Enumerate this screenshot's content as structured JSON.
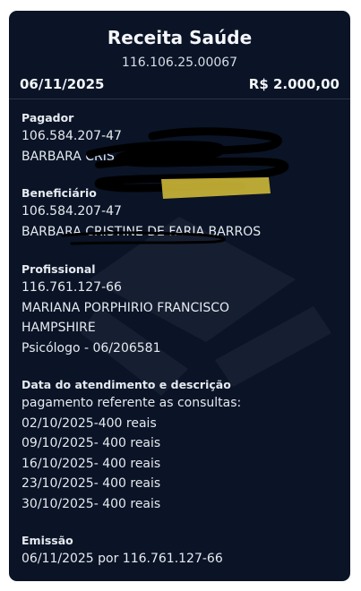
{
  "header": {
    "title": "Receita Saúde",
    "receipt_number": "116.106.25.00067",
    "date": "06/11/2025",
    "amount": "R$ 2.000,00"
  },
  "pagador": {
    "label": "Pagador",
    "cpf": "106.584.207-47",
    "name": "BARBARA CRIS"
  },
  "beneficiario": {
    "label": "Beneficiário",
    "cpf": "106.584.207-47",
    "name": "BARBARA CRISTINE DE FARIA BARROS"
  },
  "profissional": {
    "label": "Profissional",
    "cpf": "116.761.127-66",
    "name_line1": "MARIANA PORPHIRIO FRANCISCO",
    "name_line2": "HAMPSHIRE",
    "registration": "Psicólogo - 06/206581"
  },
  "atendimento": {
    "label": "Data do atendimento e descrição",
    "lines": [
      "pagamento referente as consultas:",
      "02/10/2025-400 reais",
      "09/10/2025- 400 reais",
      "16/10/2025- 400 reais",
      "23/10/2025- 400  reais",
      "30/10/2025- 400 reais"
    ]
  },
  "emissao": {
    "label": "Emissão",
    "value": "06/11/2025  por 116.761.127-66"
  },
  "colors": {
    "card_background": "#0a1426",
    "text": "#e8ecf2",
    "redaction": "#000000",
    "highlight": "#d9c23a"
  }
}
